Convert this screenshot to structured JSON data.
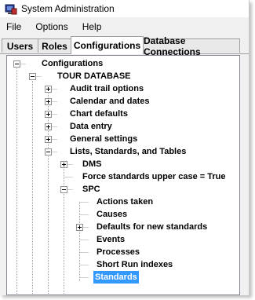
{
  "window": {
    "title": "System Administration",
    "icon": "system-admin-app-icon"
  },
  "menu": {
    "items": [
      "File",
      "Options",
      "Help"
    ]
  },
  "tabs": {
    "items": [
      "Users",
      "Roles",
      "Configurations",
      "Database Connections"
    ],
    "active": "Configurations"
  },
  "tree": {
    "nodes": [
      {
        "label": "Configurations",
        "state": "expanded"
      },
      {
        "label": "TOUR DATABASE",
        "state": "expanded"
      },
      {
        "label": "Audit trail options",
        "state": "collapsed"
      },
      {
        "label": "Calendar and dates",
        "state": "collapsed"
      },
      {
        "label": "Chart defaults",
        "state": "collapsed"
      },
      {
        "label": "Data entry",
        "state": "collapsed"
      },
      {
        "label": "General settings",
        "state": "collapsed"
      },
      {
        "label": "Lists, Standards, and Tables",
        "state": "expanded"
      },
      {
        "label": "DMS",
        "state": "collapsed"
      },
      {
        "label": "Force standards upper case = True",
        "state": "leaf"
      },
      {
        "label": "SPC",
        "state": "expanded"
      },
      {
        "label": "Actions taken",
        "state": "leaf"
      },
      {
        "label": "Causes",
        "state": "leaf"
      },
      {
        "label": "Defaults for new standards",
        "state": "collapsed"
      },
      {
        "label": "Events",
        "state": "leaf"
      },
      {
        "label": "Processes",
        "state": "leaf"
      },
      {
        "label": "Short Run indexes",
        "state": "leaf"
      },
      {
        "label": "Standards",
        "state": "leaf",
        "selected": true
      }
    ]
  },
  "colors": {
    "selection": "#3399ff",
    "selection_text": "#ffffff",
    "tree_lines": "#a0a0a0"
  }
}
